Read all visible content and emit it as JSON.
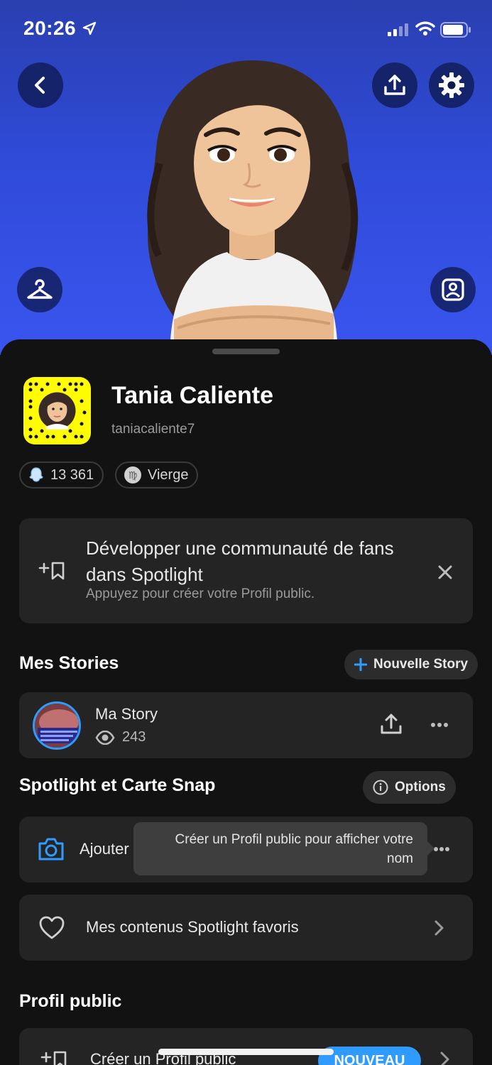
{
  "status_bar": {
    "time": "20:26"
  },
  "colors": {
    "hero_top": "#2a3fb0",
    "hero_bottom": "#3a55ef",
    "snapcode_yellow": "#fffc00",
    "accent_blue": "#2f9bff",
    "sheet_bg": "#121212",
    "card_bg": "#242424"
  },
  "hero": {
    "icons": [
      "back-icon",
      "share-icon",
      "settings-icon",
      "hanger-icon",
      "photo-icon"
    ]
  },
  "profile": {
    "display_name": "Tania Caliente",
    "username": "taniacaliente7",
    "score": "13 361",
    "zodiac": "Vierge"
  },
  "promo": {
    "title": "Développer une communauté de fans dans Spotlight",
    "subtitle": "Appuyez pour créer votre Profil public."
  },
  "stories": {
    "section_title": "Mes Stories",
    "new_story_label": "Nouvelle Story",
    "item": {
      "title": "Ma Story",
      "views": "243"
    }
  },
  "spotlight": {
    "section_title": "Spotlight et Carte Snap",
    "options_label": "Options",
    "add_label": "Ajouter",
    "tooltip": "Créer un Profil public pour afficher votre nom",
    "favorites_label": "Mes contenus Spotlight favoris"
  },
  "public_profile": {
    "section_title": "Profil public",
    "create_label": "Créer un Profil public",
    "badge": "NOUVEAU"
  }
}
